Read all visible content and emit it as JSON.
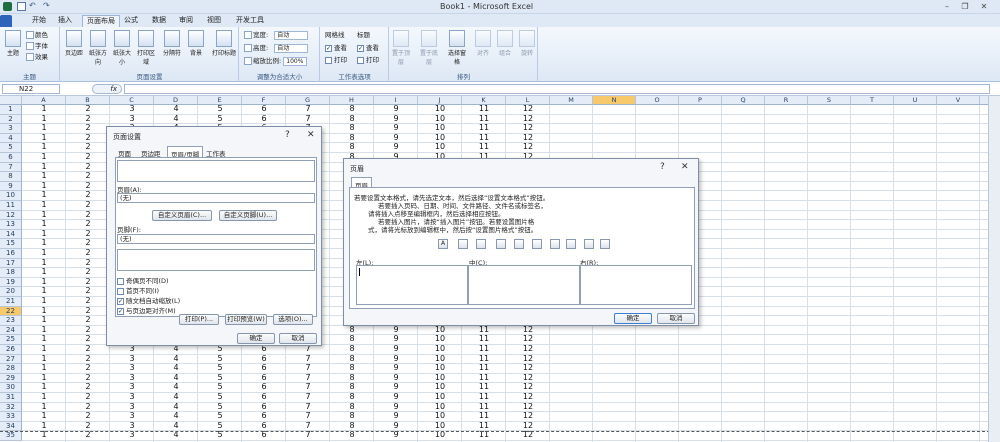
{
  "window": {
    "title": "Book1 - Microsoft Excel"
  },
  "tabs": [
    "开始",
    "插入",
    "页面布局",
    "公式",
    "数据",
    "审阅",
    "视图",
    "开发工具"
  ],
  "ribbon": {
    "theme_group": {
      "label": "主题",
      "main_btn": "主题",
      "colors": "颜色",
      "fonts": "字体",
      "effects": "效果"
    },
    "page_setup": {
      "label": "页面设置",
      "buttons": [
        "页边距",
        "纸张方向",
        "纸张大小",
        "打印区域",
        "分隔符",
        "背景",
        "打印标题"
      ]
    },
    "scale_fit": {
      "label": "调整为合适大小",
      "width_label": "宽度:",
      "width_value": "自动",
      "height_label": "高度:",
      "height_value": "自动",
      "scale_label": "缩放比例:",
      "scale_value": "100%"
    },
    "sheet_options": {
      "label": "工作表选项",
      "gridlines": "网格线",
      "headings": "标题",
      "view": "查看",
      "print": "打印"
    },
    "arrange": {
      "label": "排列",
      "buttons": [
        "置于顶层",
        "置于底层",
        "选择窗格",
        "对齐",
        "组合",
        "旋转"
      ]
    }
  },
  "formula_bar": {
    "name_box": "N22",
    "fx": "fx"
  },
  "grid": {
    "columns": [
      "A",
      "B",
      "C",
      "D",
      "E",
      "F",
      "G",
      "H",
      "I",
      "J",
      "K",
      "L",
      "M",
      "N",
      "O",
      "P",
      "Q",
      "R",
      "S",
      "T",
      "U",
      "V",
      "W"
    ],
    "selected_column": "N",
    "selected_row": "22",
    "row_numbers": [
      "1",
      "2",
      "3",
      "4",
      "5",
      "6",
      "7",
      "8",
      "9",
      "10",
      "11",
      "12",
      "13",
      "14",
      "15",
      "16",
      "17",
      "18",
      "19",
      "20",
      "21",
      "22",
      "23",
      "24",
      "25",
      "26",
      "27",
      "28",
      "29",
      "30",
      "31",
      "32",
      "33",
      "34",
      "35"
    ],
    "row_values": [
      "1",
      "2",
      "3",
      "4",
      "5",
      "6",
      "7",
      "8",
      "9",
      "10",
      "11",
      "12"
    ]
  },
  "page_setup_dialog": {
    "title": "页面设置",
    "help": "?",
    "close": "✕",
    "tabs": [
      "页面",
      "页边距",
      "页眉/页脚",
      "工作表"
    ],
    "header_label": "页眉(A):",
    "header_value": "(无)",
    "custom_header": "自定义页眉(C)...",
    "custom_footer": "自定义页脚(U)...",
    "footer_label": "页脚(F):",
    "footer_value": "(无)",
    "options": [
      "奇偶页不同(D)",
      "首页不同(I)",
      "随文档自动缩放(L)",
      "与页边距对齐(M)"
    ],
    "print_btn": "打印(P)...",
    "preview_btn": "打印预览(W)",
    "options_btn": "选项(O)...",
    "ok": "确定",
    "cancel": "取消"
  },
  "header_dialog": {
    "title": "页眉",
    "help": "?",
    "close": "✕",
    "tab": "页眉",
    "instructions": [
      "若要设置文本格式，请先选定文本，然后选择“设置文本格式”按钮。",
      "若要插入页码、日期、时间、文件路径、文件名或标签名，",
      "请将插入点移至编辑框内，然后选择相应按钮。",
      "若要插入图片，请按“插入图片”按钮。若要设置图片格",
      "式，请将光标放到编辑框中，然后按“设置图片格式”按钮。"
    ],
    "left_label": "左(L):",
    "center_label": "中(C):",
    "right_label": "右(R):",
    "ok": "确定",
    "cancel": "取消"
  }
}
